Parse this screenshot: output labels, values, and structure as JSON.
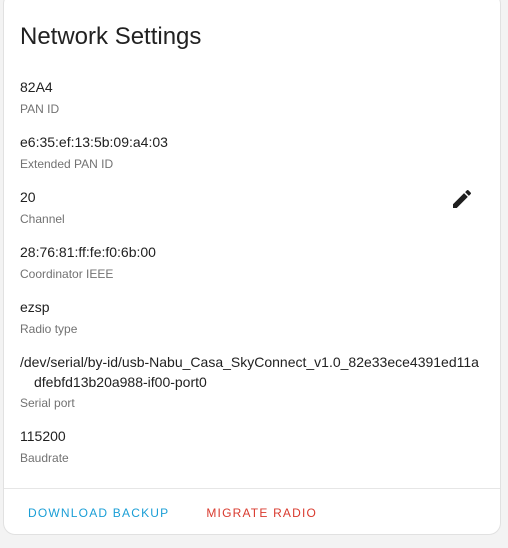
{
  "card": {
    "title": "Network Settings"
  },
  "settings": [
    {
      "value": "82A4",
      "label": "PAN ID"
    },
    {
      "value": "e6:35:ef:13:5b:09:a4:03",
      "label": "Extended PAN ID"
    },
    {
      "value": "20",
      "label": "Channel",
      "editable": true
    },
    {
      "value": "28:76:81:ff:fe:f0:6b:00",
      "label": "Coordinator IEEE"
    },
    {
      "value": "ezsp",
      "label": "Radio type"
    },
    {
      "value": "/dev/serial/by-id/usb-Nabu_Casa_SkyConnect_v1.0_82e33ece4391ed11adfebfd13b20a988-if00-port0",
      "label": "Serial port"
    },
    {
      "value": "115200",
      "label": "Baudrate"
    }
  ],
  "icons": {
    "edit": "pencil-icon"
  },
  "actions": {
    "download_backup": "DOWNLOAD BACKUP",
    "migrate_radio": "MIGRATE RADIO"
  },
  "colors": {
    "primary": "#1a9ed6",
    "danger": "#d93a2e"
  }
}
